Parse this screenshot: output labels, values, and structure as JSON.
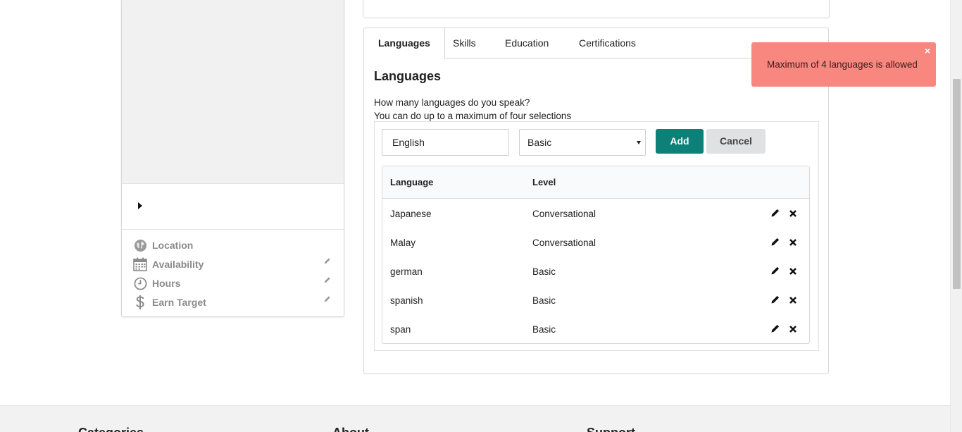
{
  "profile_sidebar": {
    "items": [
      {
        "label": "Location",
        "icon": "globe-icon",
        "editable": false
      },
      {
        "label": "Availability",
        "icon": "calendar-icon",
        "editable": true
      },
      {
        "label": "Hours",
        "icon": "clock-icon",
        "editable": true
      },
      {
        "label": "Earn Target",
        "icon": "dollar-icon",
        "editable": true
      }
    ]
  },
  "tabs": [
    {
      "label": "Languages",
      "active": true
    },
    {
      "label": "Skills",
      "active": false
    },
    {
      "label": "Education",
      "active": false
    },
    {
      "label": "Certifications",
      "active": false
    }
  ],
  "languages": {
    "title": "Languages",
    "question_line1": "How many languages do you speak?",
    "question_line2": "You can do up to a maximum of four selections",
    "input_value": "English",
    "level_selected": "Basic",
    "add_label": "Add",
    "cancel_label": "Cancel",
    "table": {
      "headers": [
        "Language",
        "Level"
      ],
      "rows": [
        {
          "language": "Japanese",
          "level": "Conversational"
        },
        {
          "language": "Malay",
          "level": "Conversational"
        },
        {
          "language": "german",
          "level": "Basic"
        },
        {
          "language": "spanish",
          "level": "Basic"
        },
        {
          "language": "span",
          "level": "Basic"
        }
      ]
    }
  },
  "toast": {
    "message": "Maximum of 4 languages is allowed",
    "close_symbol": "×",
    "color": "#f8877f"
  },
  "footer": {
    "columns": [
      "Categories",
      "About",
      "Support"
    ]
  },
  "colors": {
    "accent": "#0d8078",
    "cancel_bg": "#e0e1e2"
  }
}
